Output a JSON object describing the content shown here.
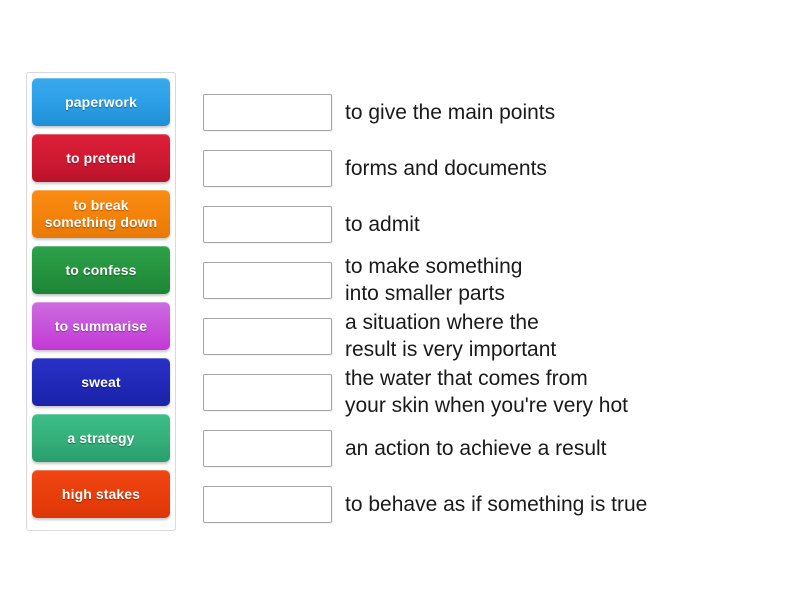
{
  "activity": {
    "type": "match-up",
    "tiles": [
      {
        "label": "paperwork",
        "color_top": "#3aa9ef",
        "color_bottom": "#1f8fd8",
        "color": "#2c9fe6"
      },
      {
        "label": "to pretend",
        "color_top": "#dd2038",
        "color_bottom": "#b9132a",
        "color": "#cf1a32"
      },
      {
        "label": "to break\nsomething down",
        "color_top": "#fa8c13",
        "color_bottom": "#e87a05",
        "color": "#f4820b"
      },
      {
        "label": "to confess",
        "color_top": "#2da24a",
        "color_bottom": "#1d8437",
        "color": "#25933f"
      },
      {
        "label": "to summarise",
        "color_top": "#cd6ce0",
        "color_bottom": "#c238d4",
        "color": "#c752da"
      },
      {
        "label": "sweat",
        "color_top": "#2a32c6",
        "color_bottom": "#1b23a8",
        "color": "#2029b8"
      },
      {
        "label": "a strategy",
        "color_top": "#3cbd88",
        "color_bottom": "#2a9e6d",
        "color": "#35b07b"
      },
      {
        "label": "high stakes",
        "color_top": "#ef4612",
        "color_bottom": "#dc3606",
        "color": "#e93e0b"
      }
    ],
    "rows": [
      {
        "answer": "",
        "definition": "to give the main points"
      },
      {
        "answer": "",
        "definition": "forms and documents"
      },
      {
        "answer": "",
        "definition": "to admit"
      },
      {
        "answer": "",
        "definition": "to make something\ninto smaller parts"
      },
      {
        "answer": "",
        "definition": "a situation where the\nresult is very important"
      },
      {
        "answer": "",
        "definition": "the water that comes from\nyour skin when you're very hot"
      },
      {
        "answer": "",
        "definition": "an action to achieve a result"
      },
      {
        "answer": "",
        "definition": "to behave as if something is true"
      }
    ]
  }
}
